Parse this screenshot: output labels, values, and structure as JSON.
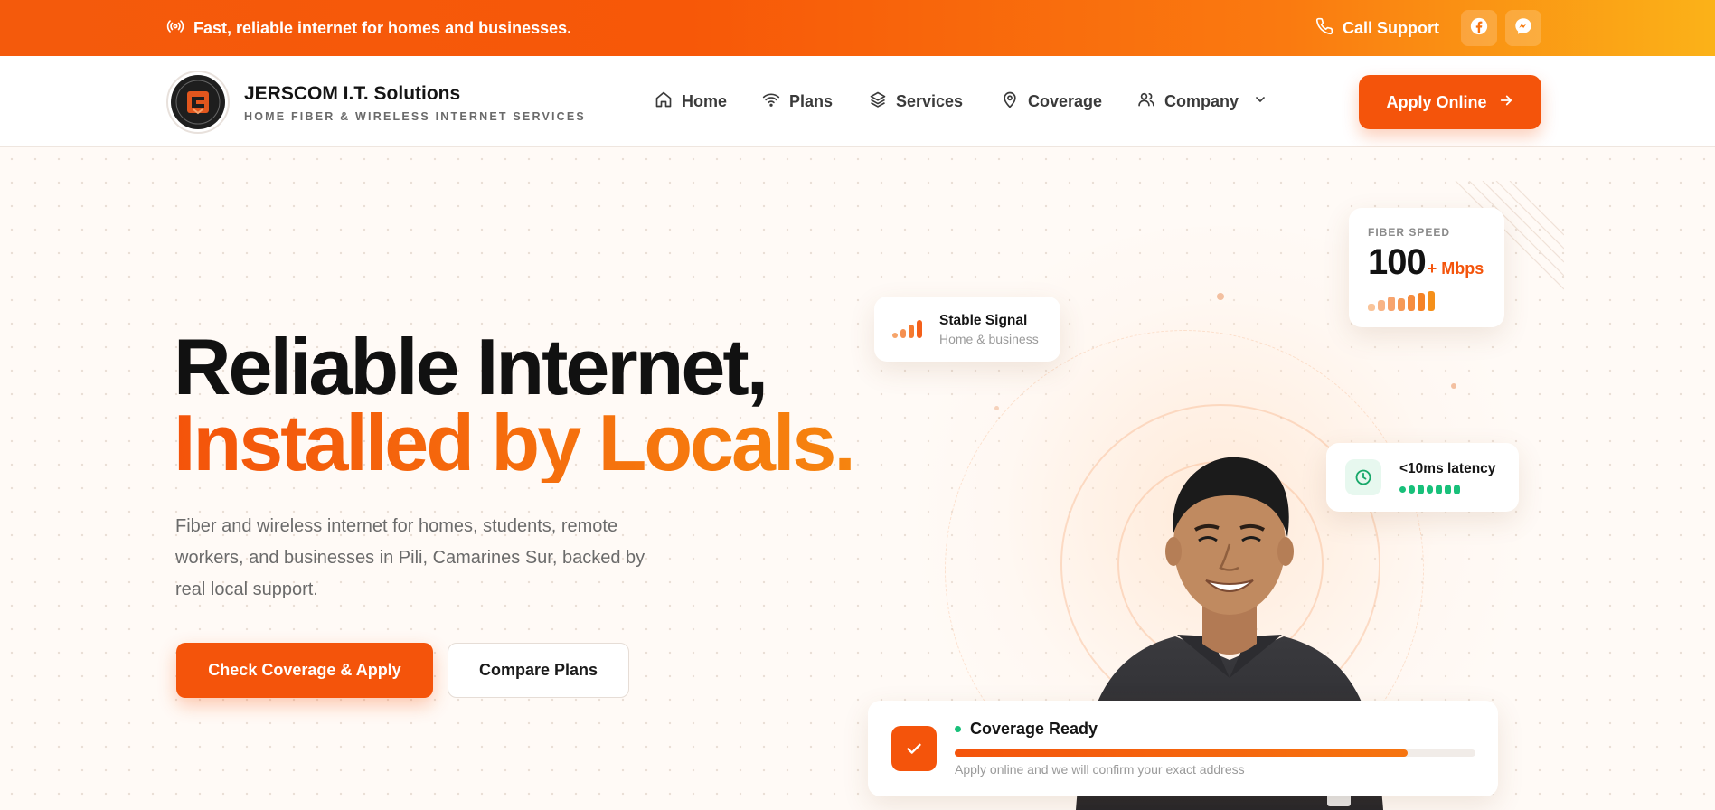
{
  "topbar": {
    "tagline": "Fast, reliable internet for homes and businesses.",
    "support_label": "Call Support",
    "icons": [
      "broadcast-icon",
      "phone-icon",
      "facebook-icon",
      "messenger-icon"
    ]
  },
  "brand": {
    "name": "JERSCOM I.T. Solutions",
    "subtitle": "HOME FIBER & WIRELESS INTERNET SERVICES"
  },
  "nav": {
    "items": [
      {
        "label": "Home",
        "icon": "home-icon"
      },
      {
        "label": "Plans",
        "icon": "wifi-icon"
      },
      {
        "label": "Services",
        "icon": "layers-icon"
      },
      {
        "label": "Coverage",
        "icon": "map-pin-icon"
      },
      {
        "label": "Company",
        "icon": "users-icon",
        "dropdown": true
      }
    ],
    "apply_label": "Apply Online"
  },
  "hero": {
    "title_line1": "Reliable Internet,",
    "title_line2": "Installed by Locals.",
    "description": "Fiber and wireless internet for homes, students, remote workers, and businesses in Pili, Camarines Sur, backed by real local support.",
    "cta_primary": "Check Coverage & Apply",
    "cta_secondary": "Compare Plans"
  },
  "cards": {
    "signal": {
      "title": "Stable Signal",
      "subtitle": "Home & business"
    },
    "speed": {
      "label": "FIBER SPEED",
      "value": "100",
      "unit": "+ Mbps"
    },
    "latency": {
      "label": "<10ms latency"
    },
    "coverage": {
      "title": "Coverage Ready",
      "note": "Apply online and we will confirm your exact address",
      "progress": 0.87
    }
  },
  "colors": {
    "brand_orange": "#f4540b",
    "accent_amber": "#fbb218",
    "status_green": "#18c07a"
  }
}
